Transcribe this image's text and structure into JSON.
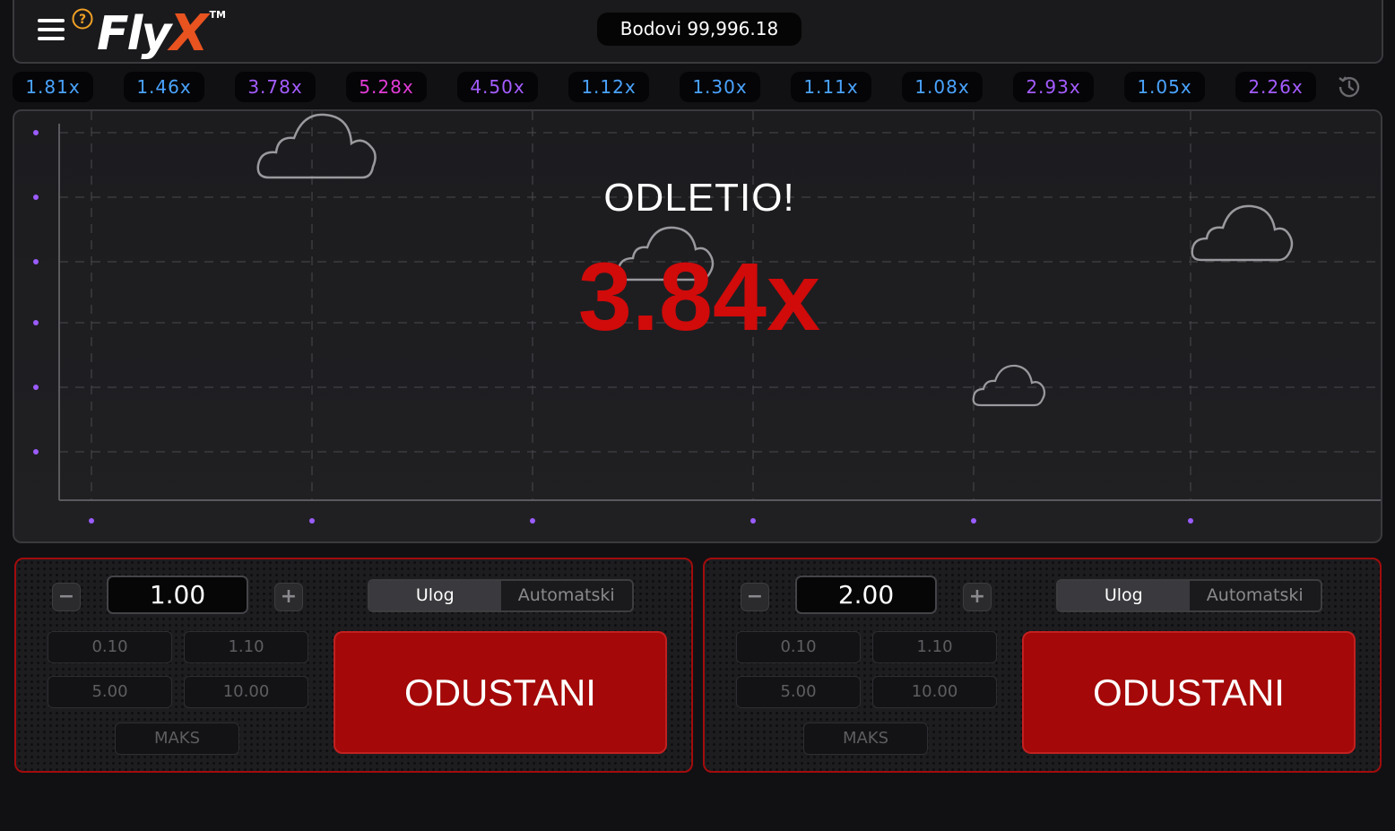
{
  "header": {
    "logo_main": "Fly",
    "logo_accent": "X",
    "logo_tm": "TM",
    "balance": "Bodovi 99,996.18",
    "icons": [
      "menu-icon",
      "help-icon",
      "history-icon"
    ]
  },
  "history": [
    {
      "label": "1.81x",
      "color": "#4aa3ff"
    },
    {
      "label": "1.46x",
      "color": "#4aa3ff"
    },
    {
      "label": "3.78x",
      "color": "#a45cff"
    },
    {
      "label": "5.28x",
      "color": "#e13bd6"
    },
    {
      "label": "4.50x",
      "color": "#a45cff"
    },
    {
      "label": "1.12x",
      "color": "#4aa3ff"
    },
    {
      "label": "1.30x",
      "color": "#4aa3ff"
    },
    {
      "label": "1.11x",
      "color": "#4aa3ff"
    },
    {
      "label": "1.08x",
      "color": "#4aa3ff"
    },
    {
      "label": "2.93x",
      "color": "#a45cff"
    },
    {
      "label": "1.05x",
      "color": "#4aa3ff"
    },
    {
      "label": "2.26x",
      "color": "#a45cff"
    }
  ],
  "game": {
    "title": "ODLETIO!",
    "multiplier": "3.84x",
    "multiplier_color": "#d10a0a",
    "axis_dot_color": "#9b5cff"
  },
  "panels": [
    {
      "amount": "1.00",
      "minus": "−",
      "plus": "+",
      "tab_bet": "Ulog",
      "tab_auto": "Automatski",
      "quick": [
        "0.10",
        "1.10",
        "5.00",
        "10.00"
      ],
      "max": "MAKS",
      "cancel": "ODUSTANI"
    },
    {
      "amount": "2.00",
      "minus": "−",
      "plus": "+",
      "tab_bet": "Ulog",
      "tab_auto": "Automatski",
      "quick": [
        "0.10",
        "1.10",
        "5.00",
        "10.00"
      ],
      "max": "MAKS",
      "cancel": "ODUSTANI"
    }
  ]
}
